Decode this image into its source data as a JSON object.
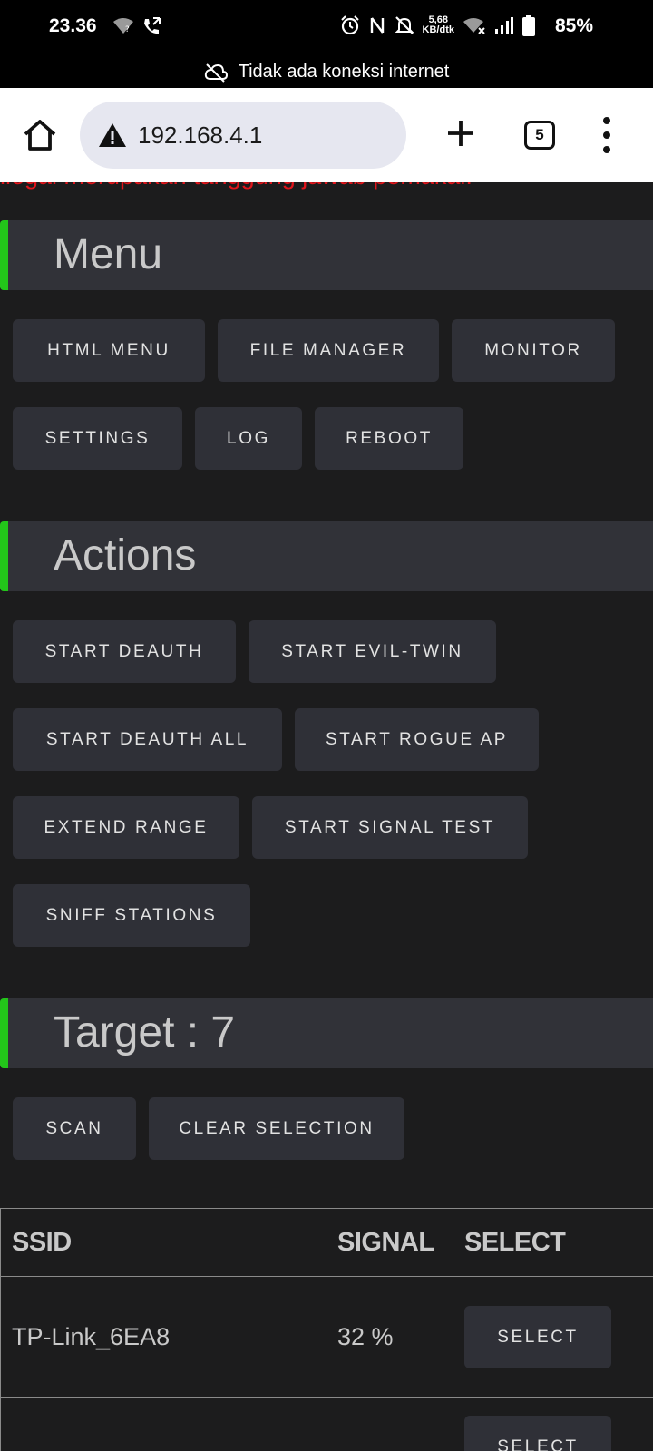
{
  "status_bar": {
    "time": "23.36",
    "speed_value": "5,68",
    "speed_unit": "KB/dtk",
    "battery": "85%"
  },
  "offline_banner": {
    "text": "Tidak ada koneksi internet"
  },
  "browser": {
    "url": "192.168.4.1",
    "tab_count": "5"
  },
  "page": {
    "warning_text": "ilegal merupakan tanggung jawab pemakai.",
    "menu": {
      "title": "Menu",
      "buttons": [
        "HTML MENU",
        "FILE MANAGER",
        "MONITOR",
        "SETTINGS",
        "LOG",
        "REBOOT"
      ]
    },
    "actions": {
      "title": "Actions",
      "buttons": [
        "START DEAUTH",
        "START EVIL-TWIN",
        "START DEAUTH ALL",
        "START ROGUE AP",
        "EXTEND RANGE",
        "START SIGNAL TEST",
        "SNIFF STATIONS"
      ]
    },
    "target": {
      "title": "Target : 7",
      "buttons": [
        "SCAN",
        "CLEAR SELECTION"
      ]
    },
    "table": {
      "headers": [
        "SSID",
        "SIGNAL",
        "SELECT"
      ],
      "rows": [
        {
          "ssid": "TP-Link_6EA8",
          "signal": "32 %",
          "select": "SELECT"
        },
        {
          "ssid": "",
          "signal": "",
          "select": "SELECT"
        }
      ]
    }
  },
  "colors": {
    "background": "#1c1c1d",
    "button": "#2f3037",
    "section_accent": "#23c51a",
    "warning": "#e0151b"
  }
}
